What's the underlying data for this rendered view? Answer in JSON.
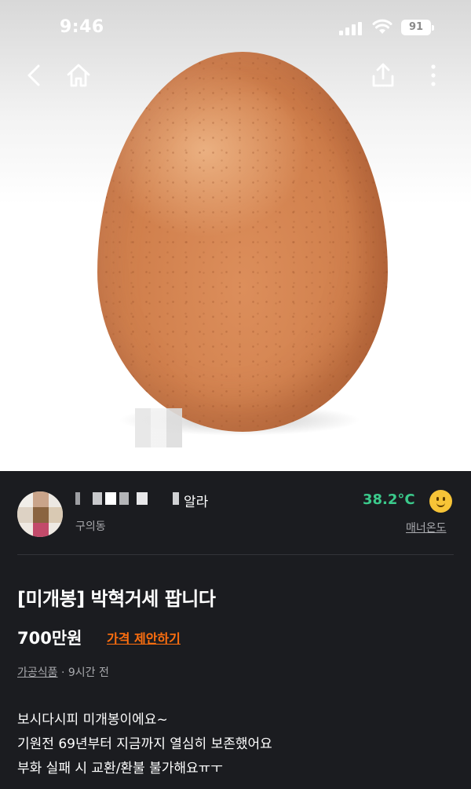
{
  "status_bar": {
    "time": "9:46",
    "battery_level": "91"
  },
  "nav": {
    "back_icon": "chevron-left-icon",
    "home_icon": "home-icon",
    "share_icon": "share-icon",
    "more_icon": "more-vertical-icon"
  },
  "seller": {
    "name_visible_suffix": "알라",
    "location": "구의동",
    "manner_temp": "38.2°C",
    "manner_label": "매너온도",
    "manner_color": "#3bc98b"
  },
  "listing": {
    "title": "[미개봉] 박혁거세 팝니다",
    "price": "700만원",
    "offer_label": "가격 제안하기",
    "category": "가공식품",
    "meta_separator": " · ",
    "posted_ago": "9시간 전",
    "accent_color": "#ff6f0f",
    "description": [
      "보시다시피 미개봉이에요~",
      "기원전 69년부터 지금까지 열심히 보존했어요",
      "부화 실패 시 교환/환불 불가해요ㅠㅜ"
    ]
  }
}
